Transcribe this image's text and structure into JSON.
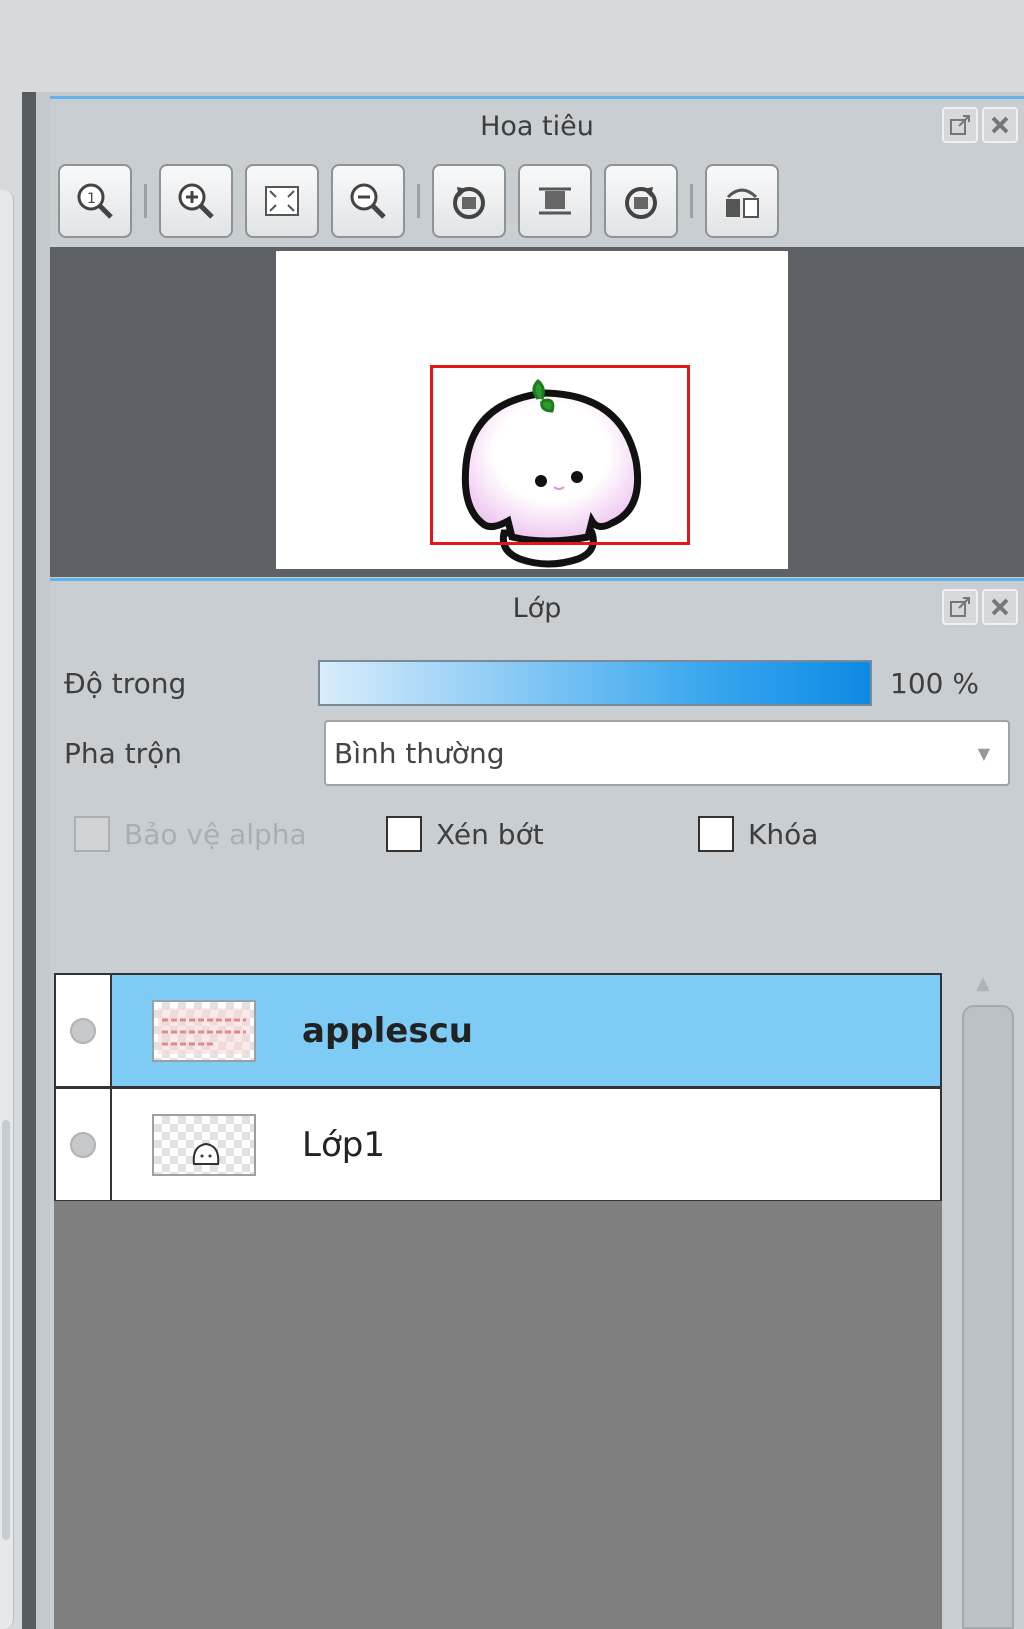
{
  "navigator": {
    "title": "Hoa tiêu",
    "tools": [
      "zoom-100-icon",
      "zoom-in-icon",
      "fit-window-icon",
      "zoom-out-icon",
      "rotate-left-icon",
      "fit-canvas-icon",
      "rotate-right-icon",
      "flip-icon"
    ]
  },
  "layers": {
    "title": "Lớp",
    "opacity_label": "Độ trong",
    "opacity_value": "100 %",
    "opacity": 1.0,
    "blend_label": "Pha trộn",
    "blend_value": "Bình thường",
    "protect_alpha_label": "Bảo vệ alpha",
    "clip_label": "Xén bớt",
    "lock_label": "Khóa",
    "items": [
      {
        "name": "applescu",
        "selected": true
      },
      {
        "name": "Lớp1",
        "selected": false
      }
    ]
  },
  "colors": {
    "accent": "#64b3e8",
    "selection": "#7ecbf5",
    "nav_frame": "#e2161b"
  }
}
